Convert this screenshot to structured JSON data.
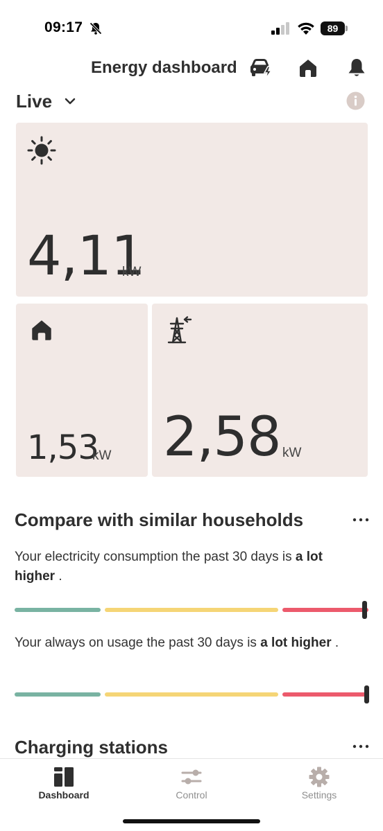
{
  "status_bar": {
    "time": "09:17",
    "battery": "89"
  },
  "header": {
    "title": "Energy dashboard"
  },
  "live": {
    "label": "Live"
  },
  "tiles": {
    "solar": {
      "icon": "sun-icon",
      "value": "4,11",
      "unit": "kW"
    },
    "home": {
      "icon": "house-icon",
      "value": "1,53",
      "unit": "kW"
    },
    "grid": {
      "icon": "power-pylon-icon",
      "value": "2,58",
      "unit": "kW"
    }
  },
  "compare": {
    "title": "Compare with similar households",
    "items": [
      {
        "text": "Your electricity consumption the past 30 days is ",
        "emphasis": "a lot higher",
        "suffix": " .",
        "level": 0.99
      },
      {
        "text": "Your always on usage the past 30 days is ",
        "emphasis": "a lot higher",
        "suffix": " .",
        "level": 1.0
      }
    ],
    "colors": {
      "low": "#79b3a2",
      "medium": "#f5d576",
      "high": "#ec5a6c"
    }
  },
  "charging": {
    "title": "Charging stations"
  },
  "nav": {
    "items": [
      {
        "label": "Dashboard",
        "icon": "dashboard-icon",
        "active": true
      },
      {
        "label": "Control",
        "icon": "sliders-icon",
        "active": false
      },
      {
        "label": "Settings",
        "icon": "gear-icon",
        "active": false
      }
    ]
  },
  "colors": {
    "tile_bg": "#f2e9e6",
    "text": "#2f2f2f",
    "inactive": "#9a9a9a"
  }
}
